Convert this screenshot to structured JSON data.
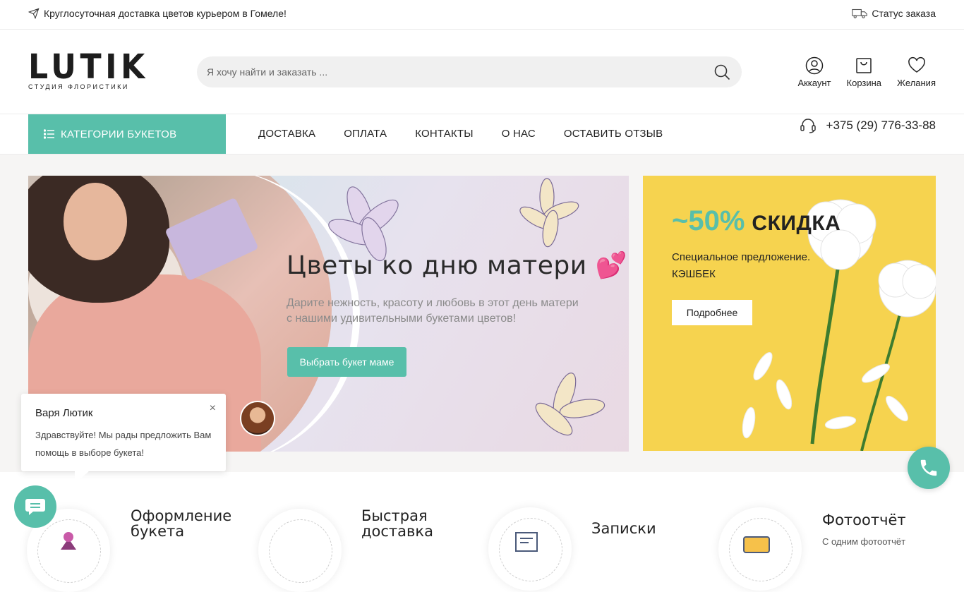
{
  "topbar": {
    "delivery_text": "Круглосуточная доставка цветов курьером в Гомеле!",
    "order_status": "Статус заказа"
  },
  "header": {
    "logo_main": "LUTIK",
    "logo_sub": "СТУДИЯ ФЛОРИСТИКИ",
    "search_placeholder": "Я хочу найти и заказать ...",
    "account": "Аккаунт",
    "cart": "Корзина",
    "wishlist": "Желания"
  },
  "nav": {
    "categories": "КАТЕГОРИИ БУКЕТОВ",
    "links": [
      "ДОСТАВКА",
      "ОПЛАТА",
      "КОНТАКТЫ",
      "О НАС",
      "ОСТАВИТЬ ОТЗЫВ"
    ],
    "phone": "+375 (29) 776-33-88"
  },
  "banner": {
    "title": "Цветы ко дню матери 💕",
    "text": "Дарите нежность, красоту и любовь в этот день матери с нашими удивительными букетами цветов!",
    "button": "Выбрать букет маме"
  },
  "promo": {
    "percent": "~50%",
    "word": "СКИДКА",
    "line1": "Специальное предложение.",
    "line2": "КЭШБЕК",
    "button": "Подробнее"
  },
  "chat": {
    "name": "Варя Лютик",
    "message": "Здравствуйте! Мы рады предложить Вам помощь в выборе букета!",
    "close": "×"
  },
  "features": [
    {
      "title": "Оформление букета",
      "sub": ""
    },
    {
      "title": "Быстрая доставка",
      "sub": ""
    },
    {
      "title": "Записки",
      "sub": ""
    },
    {
      "title": "Фотоотчёт",
      "sub": "С одним фотоотчёт"
    }
  ],
  "colors": {
    "accent": "#58bfaa",
    "promo_bg": "#f6d34f",
    "text": "#222222"
  }
}
